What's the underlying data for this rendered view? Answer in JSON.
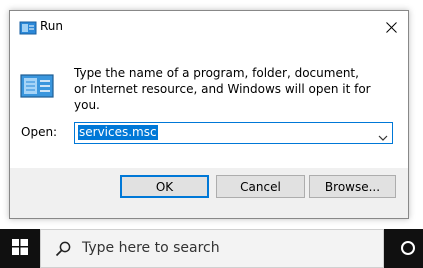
{
  "dialog": {
    "title": "Run",
    "description": "Type the name of a program, folder, document, or Internet resource, and Windows will open it for you.",
    "open_label": "Open:",
    "open_value": "services.msc",
    "buttons": {
      "ok": "OK",
      "cancel": "Cancel",
      "browse": "Browse..."
    },
    "icons": {
      "title": "run-icon",
      "close": "close-icon",
      "dropdown": "chevron-down-icon"
    }
  },
  "taskbar": {
    "search_placeholder": "Type here to search",
    "icons": {
      "start": "windows-start-icon",
      "search": "search-icon",
      "cortana": "cortana-circle-icon"
    }
  },
  "colors": {
    "accent": "#0078d7",
    "taskbar": "#101010",
    "footer": "#f0f0f0",
    "button": "#e1e1e1"
  }
}
